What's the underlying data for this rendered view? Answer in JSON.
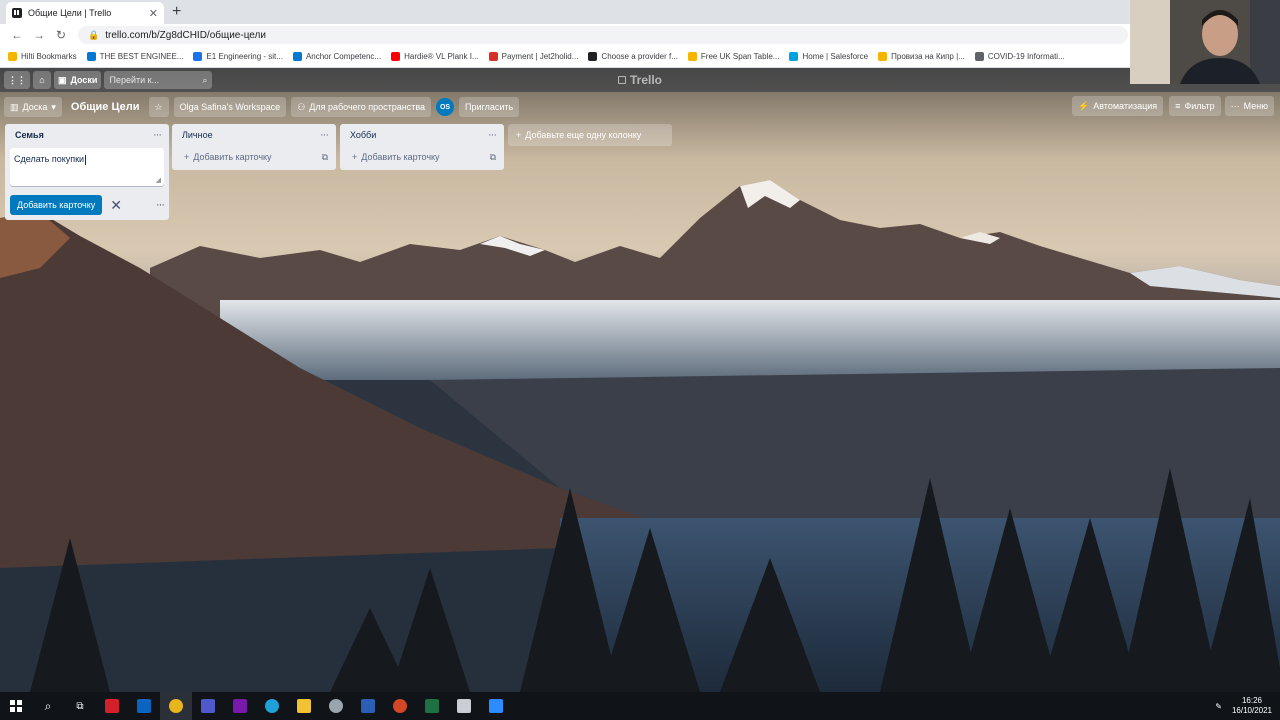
{
  "browser": {
    "tab_title": "Общие Цели | Trello",
    "url": "trello.com/b/Zg8dCHID/общие-цели"
  },
  "bookmarks": [
    {
      "label": "Hilti Bookmarks",
      "color": "#f4b400"
    },
    {
      "label": "THE BEST ENGINEE...",
      "color": "#0078d4"
    },
    {
      "label": "E1 Engineering - sit...",
      "color": "#1a73e8"
    },
    {
      "label": "Anchor Competenc...",
      "color": "#0078d4"
    },
    {
      "label": "Hardie® VL Plank I...",
      "color": "#ff0000"
    },
    {
      "label": "Payment | Jet2holid...",
      "color": "#d93025"
    },
    {
      "label": "Choose a provider f...",
      "color": "#202124"
    },
    {
      "label": "Free UK Span Table...",
      "color": "#f4b400"
    },
    {
      "label": "Home | Salesforce",
      "color": "#00a1e0"
    },
    {
      "label": "Провиза на Кипр |...",
      "color": "#f4b400"
    },
    {
      "label": "COVID-19 Informati...",
      "color": "#5f6368"
    }
  ],
  "trello_header": {
    "boards_label": "Доски",
    "search_placeholder": "Перейти к...",
    "logo": "Trello"
  },
  "board_header": {
    "view_label": "Доска",
    "board_title": "Общие Цели",
    "workspace": "Olga Safina's Workspace",
    "visibility": "Для рабочего пространства",
    "avatar_initials": "OS",
    "invite_label": "Пригласить",
    "automation_label": "Автоматизация",
    "filter_label": "Фильтр",
    "menu_label": "Меню"
  },
  "lists": [
    {
      "title": "Семья",
      "composer_text": "Сделать покупки",
      "add_card_button": "Добавить карточку"
    },
    {
      "title": "Личное",
      "add_card": "Добавить карточку"
    },
    {
      "title": "Хобби",
      "add_card": "Добавить карточку"
    }
  ],
  "add_list_label": "Добавьте еще одну колонку",
  "taskbar": {
    "time": "16:26",
    "date": "16/10/2021"
  }
}
